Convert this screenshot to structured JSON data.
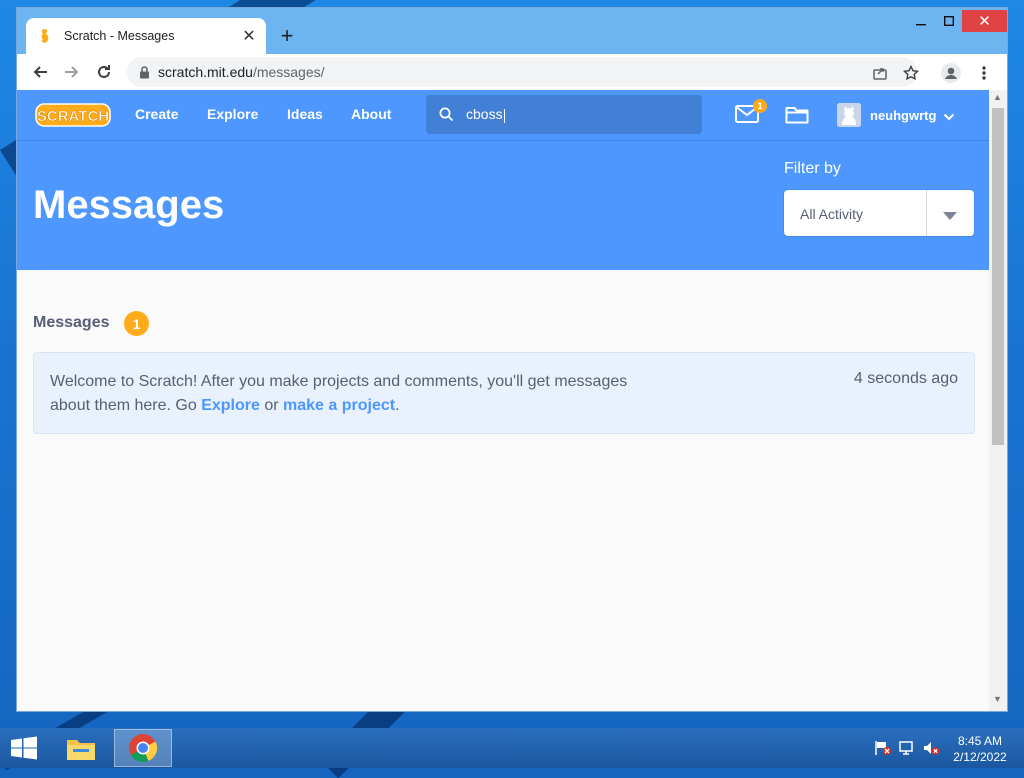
{
  "browser": {
    "tab_title": "Scratch - Messages",
    "url_host": "scratch.mit.edu",
    "url_path": "/messages/"
  },
  "nav": {
    "logo": "SCRATCH",
    "links": [
      "Create",
      "Explore",
      "Ideas",
      "About"
    ],
    "search_value": "cboss",
    "message_badge": "1",
    "username": "neuhgwrtg"
  },
  "banner": {
    "title": "Messages",
    "filter_label": "Filter by",
    "filter_value": "All Activity"
  },
  "messages": {
    "heading": "Messages",
    "count": "1",
    "items": [
      {
        "text_before": "Welcome to Scratch! After you make projects and comments, you'll get messages about them here. Go ",
        "link_explore": "Explore",
        "text_or": " or ",
        "link_make": "make a project",
        "text_after": ".",
        "time": "4 seconds ago"
      }
    ]
  },
  "taskbar": {
    "time": "8:45 AM",
    "date": "2/12/2022"
  },
  "colors": {
    "scratch_blue": "#4d97ff",
    "scratch_orange": "#ffab1a",
    "text_gray": "#575e75"
  }
}
